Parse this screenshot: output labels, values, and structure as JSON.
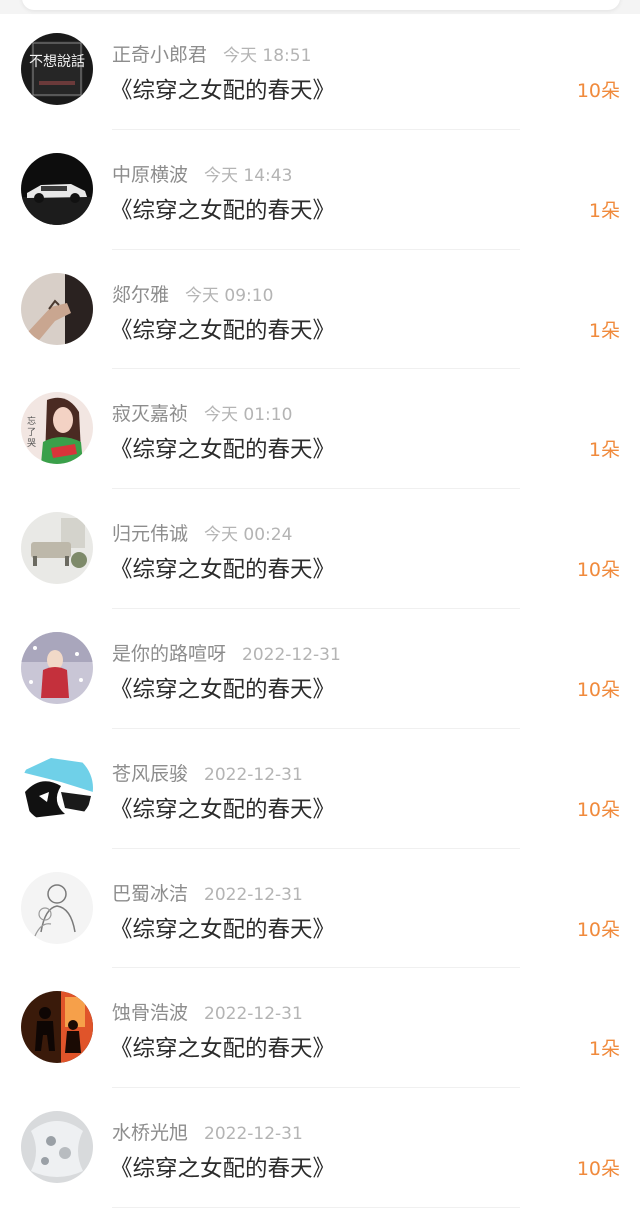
{
  "records": [
    {
      "name": "正奇小郎君",
      "time": "今天 18:51",
      "title": "《综穿之女配的春天》",
      "amount": "10朵",
      "avatar_icon": "text-avatar-icon",
      "avatar_text": "不想說話",
      "avatar_colors": [
        "#1a1a1a",
        "#6b3a3a"
      ]
    },
    {
      "name": "中原横波",
      "time": "今天 14:43",
      "title": "《综穿之女配的春天》",
      "amount": "1朵",
      "avatar_icon": "car-avatar-icon",
      "avatar_colors": [
        "#0d0d0d",
        "#e8e8e8"
      ]
    },
    {
      "name": "郯尔雅",
      "time": "今天 09:10",
      "title": "《综穿之女配的春天》",
      "amount": "1朵",
      "avatar_icon": "hand-avatar-icon",
      "avatar_colors": [
        "#d8cfc8",
        "#2a2220"
      ]
    },
    {
      "name": "寂灭嘉祯",
      "time": "今天 01:10",
      "title": "《综穿之女配的春天》",
      "amount": "1朵",
      "avatar_icon": "girl-avatar-icon",
      "avatar_text": "忘了哭",
      "avatar_colors": [
        "#f2e6e2",
        "#3aa04a"
      ]
    },
    {
      "name": "归元伟诚",
      "time": "今天 00:24",
      "title": "《综穿之女配的春天》",
      "amount": "10朵",
      "avatar_icon": "room-avatar-icon",
      "avatar_colors": [
        "#e9e9e6",
        "#6b6a60"
      ]
    },
    {
      "name": "是你的路喧呀",
      "time": "2022-12-31",
      "title": "《综穿之女配的春天》",
      "amount": "10朵",
      "avatar_icon": "snow-avatar-icon",
      "avatar_colors": [
        "#c9c6d6",
        "#c4303c"
      ]
    },
    {
      "name": "苍风辰骏",
      "time": "2022-12-31",
      "title": "《综穿之女配的春天》",
      "amount": "10朵",
      "avatar_icon": "anime-avatar-icon",
      "avatar_colors": [
        "#6fd0e8",
        "#111111"
      ]
    },
    {
      "name": "巴蜀冰洁",
      "time": "2022-12-31",
      "title": "《综穿之女配的春天》",
      "amount": "10朵",
      "avatar_icon": "sketch-avatar-icon",
      "avatar_colors": [
        "#f4f4f4",
        "#7a7a7a"
      ]
    },
    {
      "name": "蚀骨浩波",
      "time": "2022-12-31",
      "title": "《综穿之女配的春天》",
      "amount": "1朵",
      "avatar_icon": "silhouette-avatar-icon",
      "avatar_colors": [
        "#3a1a0a",
        "#e0542a"
      ]
    },
    {
      "name": "水桥光旭",
      "time": "2022-12-31",
      "title": "《综穿之女配的春天》",
      "amount": "10朵",
      "avatar_icon": "lace-avatar-icon",
      "avatar_colors": [
        "#d8dadc",
        "#9aa0a6"
      ]
    }
  ],
  "colors": {
    "name": "#8d8d8d",
    "time": "#b4b4b4",
    "title": "#2b2b2b",
    "amount": "#f08a3c"
  }
}
